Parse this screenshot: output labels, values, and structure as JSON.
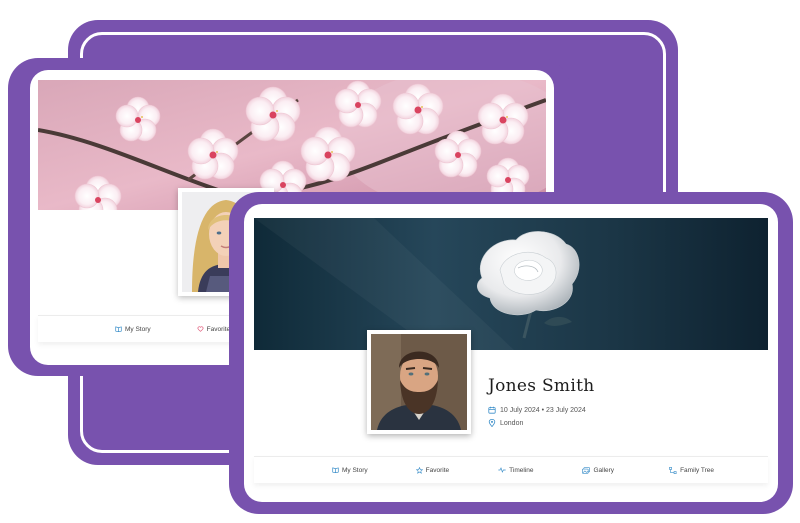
{
  "profile": {
    "name": "Jones Smith",
    "dates": "10 July 2024 • 23 July 2024",
    "location": "London"
  },
  "back_card": {
    "nav": [
      {
        "label": "My Story",
        "icon": "book-icon"
      },
      {
        "label": "Favorite",
        "icon": "heart-icon"
      }
    ]
  },
  "front_card": {
    "nav": [
      {
        "label": "My Story",
        "icon": "book-icon"
      },
      {
        "label": "Favorite",
        "icon": "star-icon"
      },
      {
        "label": "Timeline",
        "icon": "pulse-icon"
      },
      {
        "label": "Gallery",
        "icon": "images-icon"
      },
      {
        "label": "Family Tree",
        "icon": "tree-icon"
      }
    ]
  },
  "colors": {
    "frame": "#7852ae",
    "icon_accent": "#3a8ec9",
    "heart_accent": "#e05a7a"
  }
}
